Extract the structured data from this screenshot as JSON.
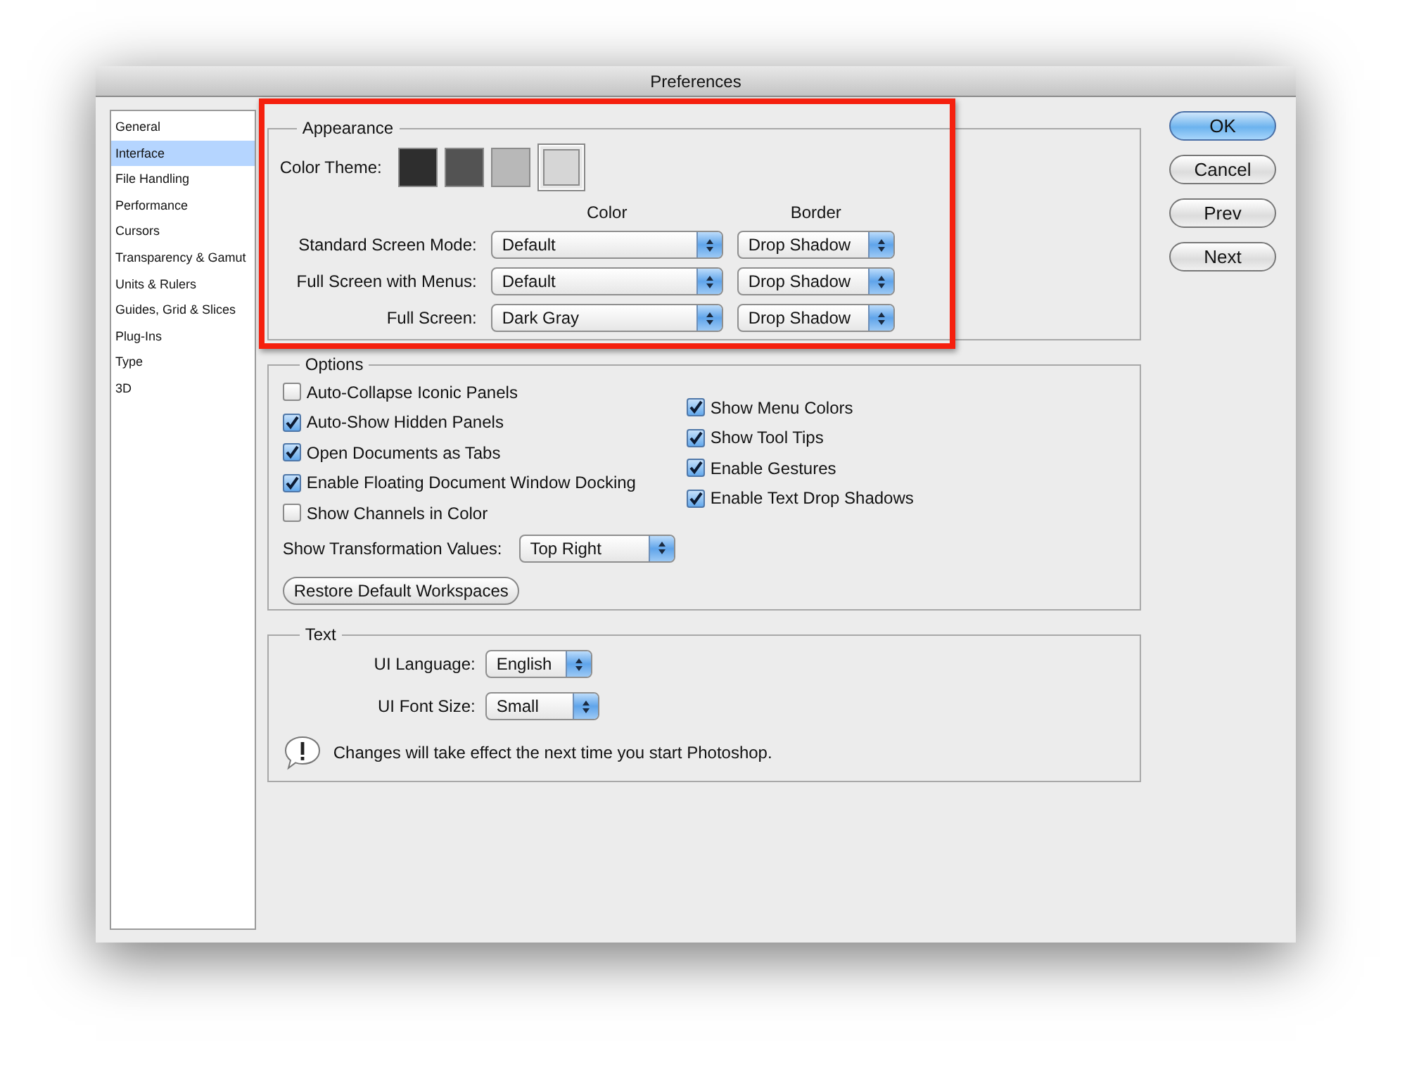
{
  "window": {
    "title": "Preferences"
  },
  "sidebar": {
    "items": [
      {
        "label": "General",
        "selected": false
      },
      {
        "label": "Interface",
        "selected": true
      },
      {
        "label": "File Handling",
        "selected": false
      },
      {
        "label": "Performance",
        "selected": false
      },
      {
        "label": "Cursors",
        "selected": false
      },
      {
        "label": "Transparency & Gamut",
        "selected": false
      },
      {
        "label": "Units & Rulers",
        "selected": false
      },
      {
        "label": "Guides, Grid & Slices",
        "selected": false
      },
      {
        "label": "Plug-Ins",
        "selected": false
      },
      {
        "label": "Type",
        "selected": false
      },
      {
        "label": "3D",
        "selected": false
      }
    ]
  },
  "appearance": {
    "title": "Appearance",
    "color_theme_label": "Color Theme:",
    "color_themes": [
      {
        "color": "#2e2e2e",
        "selected": false
      },
      {
        "color": "#535353",
        "selected": false
      },
      {
        "color": "#b8b8b8",
        "selected": false
      },
      {
        "color": "#d6d6d6",
        "selected": true
      }
    ],
    "columns": [
      "Color",
      "Border"
    ],
    "rows": [
      {
        "label": "Standard Screen Mode:",
        "color_mode": "Default",
        "border": "Drop Shadow"
      },
      {
        "label": "Full Screen with Menus:",
        "color_mode": "Default",
        "border": "Drop Shadow"
      },
      {
        "label": "Full Screen:",
        "color_mode": "Dark Gray",
        "border": "Drop Shadow"
      }
    ]
  },
  "options": {
    "title": "Options",
    "left_column": [
      {
        "label": "Auto-Collapse Iconic Panels",
        "checked": false
      },
      {
        "label": "Auto-Show Hidden Panels",
        "checked": true
      },
      {
        "label": "Open Documents as Tabs",
        "checked": true
      },
      {
        "label": "Enable Floating Document Window Docking",
        "checked": true
      },
      {
        "label": "Show Channels in Color",
        "checked": false
      }
    ],
    "right_column": [
      {
        "label": "Show Menu Colors",
        "checked": true
      },
      {
        "label": "Show Tool Tips",
        "checked": true
      },
      {
        "label": "Enable Gestures",
        "checked": true
      },
      {
        "label": "Enable Text Drop Shadows",
        "checked": true
      }
    ],
    "transformation_label": "Show Transformation Values:",
    "transformation_value": "Top Right",
    "restore_button": "Restore Default Workspaces"
  },
  "text": {
    "title": "Text",
    "fields": [
      {
        "label": "UI Language:",
        "value": "English"
      },
      {
        "label": "UI Font Size:",
        "value": "Small"
      }
    ],
    "notice": "Changes will take effect the next time you start Photoshop."
  },
  "buttons": [
    {
      "label": "OK",
      "kind": "default"
    },
    {
      "label": "Cancel",
      "kind": "normal"
    },
    {
      "label": "Prev",
      "kind": "normal"
    },
    {
      "label": "Next",
      "kind": "normal"
    }
  ]
}
